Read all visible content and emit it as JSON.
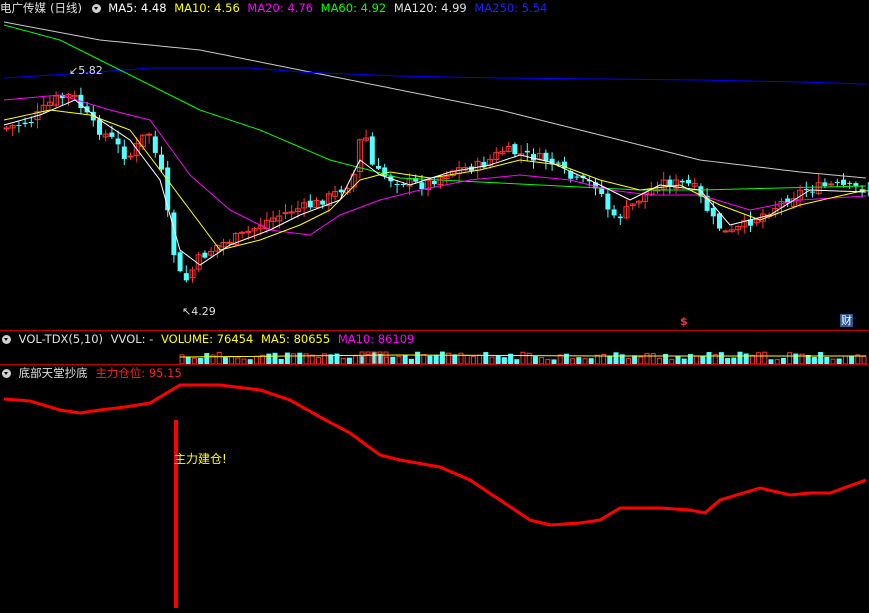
{
  "main": {
    "title": "电广传媒",
    "period": "(日线)",
    "ma": [
      {
        "label": "MA5: 4.48",
        "color": "#ffffff"
      },
      {
        "label": "MA10: 4.56",
        "color": "#ffff00"
      },
      {
        "label": "MA20: 4.76",
        "color": "#ff00ff"
      },
      {
        "label": "MA60: 4.92",
        "color": "#00ff00"
      },
      {
        "label": "MA120: 4.99",
        "color": "#e0e0e0"
      },
      {
        "label": "MA250: 5.54",
        "color": "#0000ff"
      }
    ],
    "high_label": "5.82",
    "low_label": "4.29",
    "marker_s": "$",
    "marker_cai": "财"
  },
  "vol": {
    "name": "VOL-TDX(5,10)",
    "vvol": "VVOL: -",
    "volume": "VOLUME: 76454",
    "ma5": "MA5: 80655",
    "ma10": "MA10: 86109"
  },
  "ind": {
    "name": "底部天堂抄底",
    "label": "主力仓位: 95.15",
    "signal": "主力建仓!"
  },
  "colors": {
    "up": "#ff3232",
    "down": "#54ffff",
    "separator": "#c00000",
    "ma5": "#ffffff",
    "ma10": "#ffff00",
    "ma20": "#ff00ff",
    "ma60": "#00ff00",
    "ma120": "#c8c8c8",
    "ma250": "#0000ff",
    "signal_line": "#ff0000",
    "signal_text": "#ffff00"
  }
}
